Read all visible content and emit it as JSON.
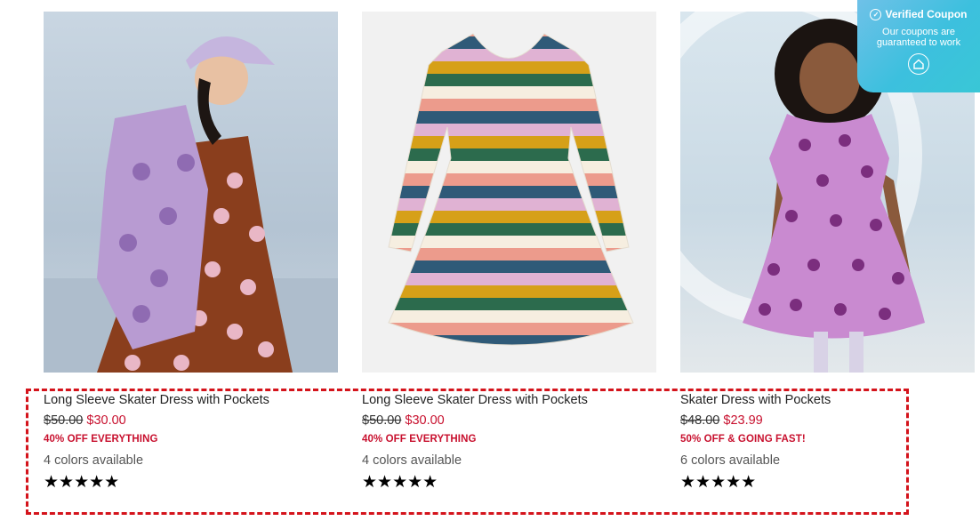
{
  "products": [
    {
      "title": "Long Sleeve Skater Dress with Pockets",
      "old_price": "$50.00",
      "new_price": "$30.00",
      "promo": "40% OFF EVERYTHING",
      "colors": "4 colors available",
      "stars": "★★★★★",
      "image_icon": "girl-heart-hoodie-photo"
    },
    {
      "title": "Long Sleeve Skater Dress with Pockets",
      "old_price": "$50.00",
      "new_price": "$30.00",
      "promo": "40% OFF EVERYTHING",
      "colors": "4 colors available",
      "stars": "★★★★★",
      "image_icon": "striped-dress-photo"
    },
    {
      "title": "Skater Dress with Pockets",
      "old_price": "$48.00",
      "new_price": "$23.99",
      "promo": "50% OFF & GOING FAST!",
      "colors": "6 colors available",
      "stars": "★★★★★",
      "image_icon": "girl-purple-heart-dress-photo"
    }
  ],
  "badge": {
    "title": "Verified Coupon",
    "subtitle": "Our coupons are guaranteed to work",
    "icon": "home-icon"
  },
  "colors": {
    "sale_red": "#c8102e",
    "highlight_border": "#d4131b",
    "badge_teal": "#3cc0de"
  }
}
